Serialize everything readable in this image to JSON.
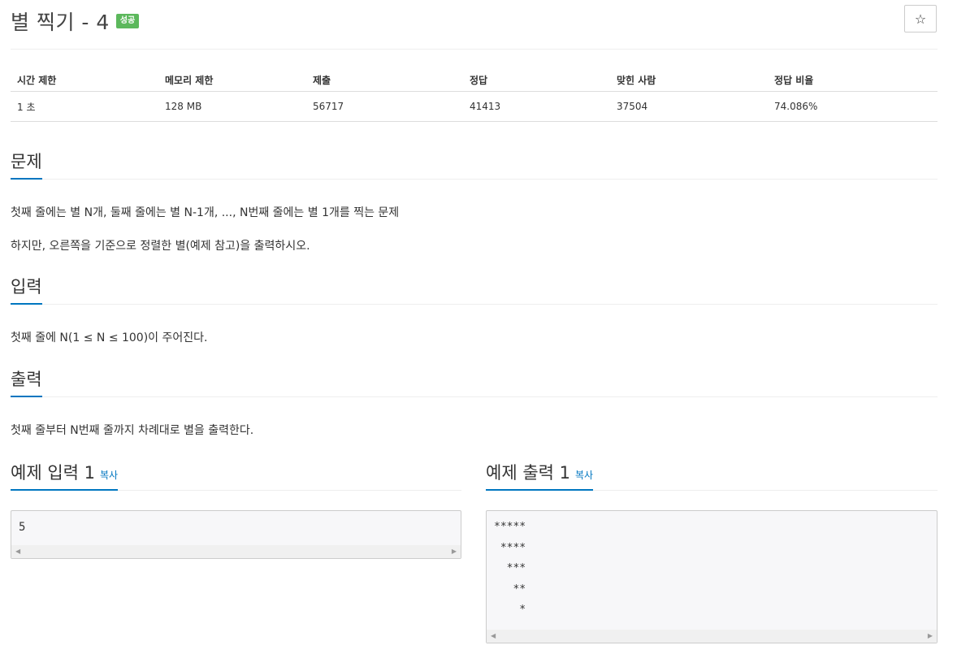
{
  "header": {
    "title": "별 찍기 - 4",
    "badge": "성공",
    "star_icon": "☆"
  },
  "info_table": {
    "headers": [
      "시간 제한",
      "메모리 제한",
      "제출",
      "정답",
      "맞힌 사람",
      "정답 비율"
    ],
    "values": [
      "1 초",
      "128 MB",
      "56717",
      "41413",
      "37504",
      "74.086%"
    ]
  },
  "problem": {
    "heading": "문제",
    "lines": [
      "첫째 줄에는 별 N개, 둘째 줄에는 별 N-1개, ..., N번째 줄에는 별 1개를 찍는 문제",
      "하지만, 오른쪽을 기준으로 정렬한 별(예제 참고)을 출력하시오."
    ]
  },
  "input": {
    "heading": "입력",
    "text": "첫째 줄에 N(1 ≤ N ≤ 100)이 주어진다."
  },
  "output": {
    "heading": "출력",
    "text": "첫째 줄부터 N번째 줄까지 차례대로 별을 출력한다."
  },
  "sample_input": {
    "heading": "예제 입력 1",
    "copy_label": "복사",
    "content": "5"
  },
  "sample_output": {
    "heading": "예제 출력 1",
    "copy_label": "복사",
    "content": "*****\n ****\n  ***\n   **\n    *"
  },
  "colors": {
    "accent": "#0076c0",
    "success": "#5cb85c"
  }
}
